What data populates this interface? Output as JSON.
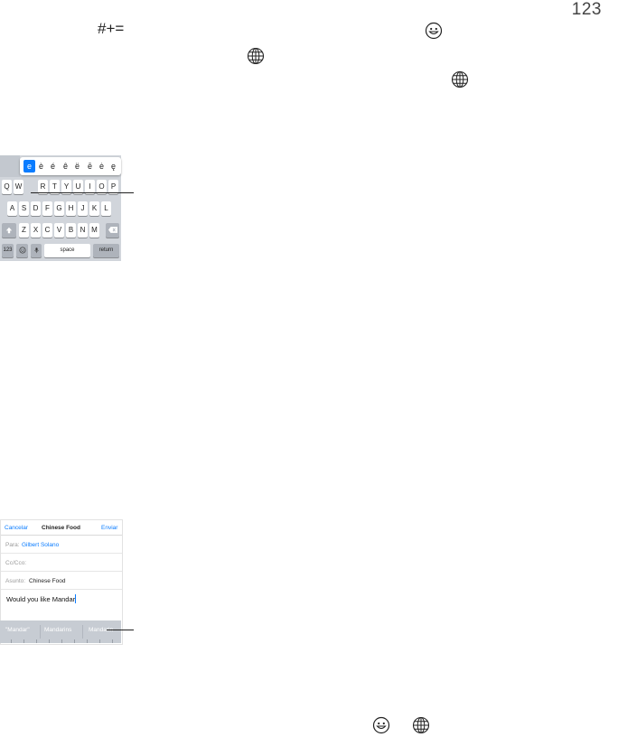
{
  "page_number": "123",
  "keys_symbol": "#+=",
  "icons": [
    "emoji-icon",
    "globe-icon"
  ],
  "keyboard": {
    "accents": [
      "e",
      "è",
      "é",
      "ê",
      "ë",
      "ē",
      "ė",
      "ę"
    ],
    "row1": [
      "Q",
      "W",
      "R",
      "T",
      "Y",
      "U",
      "I",
      "O",
      "P"
    ],
    "row2": [
      "A",
      "S",
      "D",
      "F",
      "G",
      "H",
      "J",
      "K",
      "L"
    ],
    "row3": [
      "Z",
      "X",
      "C",
      "V",
      "B",
      "N",
      "M"
    ],
    "key_123": "123",
    "key_space": "space",
    "key_return": "return"
  },
  "mail": {
    "cancel": "Cancelar",
    "title": "Chinese Food",
    "send": "Enviar",
    "to_label": "Para:",
    "to_value": "Gilbert Solano",
    "cc_label": "Cc/Cco:",
    "subject_label": "Asunto:",
    "subject_value": "Chinese Food",
    "body": "Would you like Mandar",
    "suggestions": [
      "\"Mandar\"",
      "Mandarins",
      "Mandarin"
    ]
  }
}
